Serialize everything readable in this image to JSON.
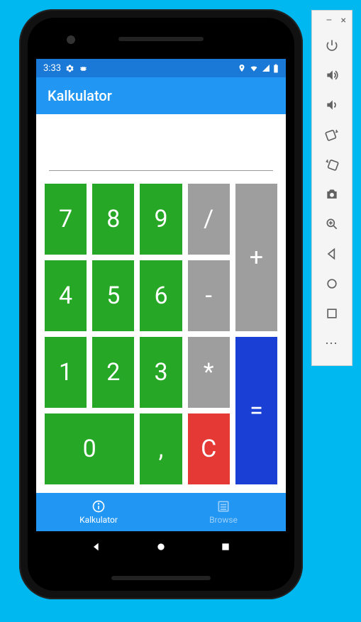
{
  "status": {
    "time": "3:33",
    "icons_right": [
      "location",
      "wifi",
      "signal",
      "battery"
    ]
  },
  "app_bar": {
    "title": "Kalkulator"
  },
  "keys": {
    "k7": "7",
    "k8": "8",
    "k9": "9",
    "div": "/",
    "plus": "+",
    "k4": "4",
    "k5": "5",
    "k6": "6",
    "minus": "-",
    "k1": "1",
    "k2": "2",
    "k3": "3",
    "mult": "*",
    "eq": "=",
    "k0": "0",
    "comma": ",",
    "clear": "C"
  },
  "tabs": {
    "calc": "Kalkulator",
    "browse": "Browse"
  },
  "emulator": {
    "minimize": "–",
    "close": "×",
    "more": "⋯"
  }
}
